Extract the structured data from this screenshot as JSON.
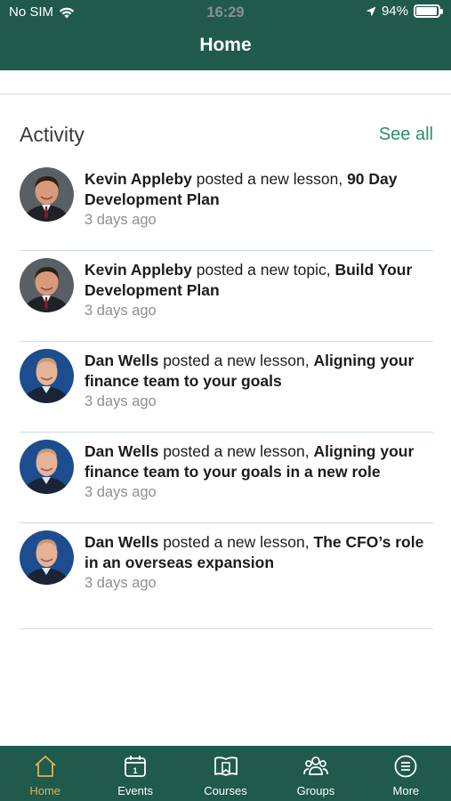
{
  "status": {
    "carrier": "No SIM",
    "time": "16:29",
    "battery": "94%",
    "battery_level": 0.94
  },
  "nav": {
    "title": "Home"
  },
  "activity": {
    "title": "Activity",
    "see_all": "See all",
    "items": [
      {
        "author": "Kevin Appleby",
        "action": "posted a new lesson,",
        "target": "90 Day Development Plan",
        "time": "3 days ago",
        "avatar": "kevin-appleby"
      },
      {
        "author": "Kevin Appleby",
        "action": "posted a new topic,",
        "target": "Build Your Development Plan",
        "time": "3 days ago",
        "avatar": "kevin-appleby"
      },
      {
        "author": "Dan Wells",
        "action": "posted a new lesson,",
        "target": "Aligning your finance team to your goals",
        "time": "3 days ago",
        "avatar": "dan-wells"
      },
      {
        "author": "Dan Wells",
        "action": "posted a new lesson,",
        "target": "Aligning your finance team to your goals in a new role",
        "time": "3 days ago",
        "avatar": "dan-wells"
      },
      {
        "author": "Dan Wells",
        "action": "posted a new lesson,",
        "target": "The CFO’s role in an overseas expansion",
        "time": "3 days ago",
        "avatar": "dan-wells"
      }
    ]
  },
  "tabs": [
    {
      "label": "Home",
      "icon": "home-icon",
      "active": true
    },
    {
      "label": "Events",
      "icon": "calendar-icon",
      "active": false,
      "badge": "1"
    },
    {
      "label": "Courses",
      "icon": "book-icon",
      "active": false
    },
    {
      "label": "Groups",
      "icon": "groups-icon",
      "active": false
    },
    {
      "label": "More",
      "icon": "menu-icon",
      "active": false
    }
  ],
  "colors": {
    "brand": "#1f5a4b",
    "link": "#2e8b6c",
    "active_tab": "#d8b45c"
  }
}
